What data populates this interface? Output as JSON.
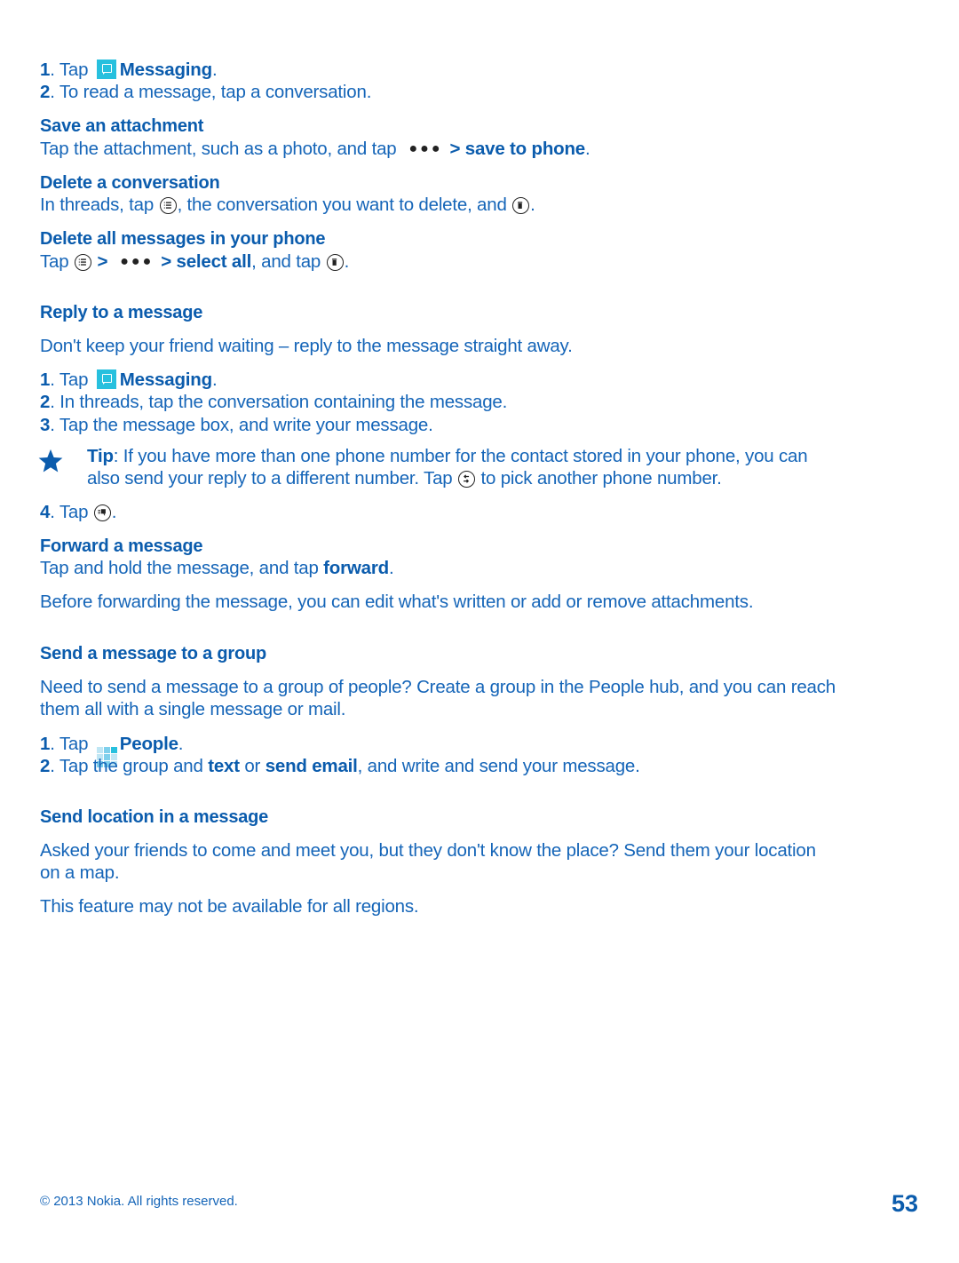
{
  "colors": {
    "body_text": "#1565b8",
    "heading": "#0b5cad",
    "messaging_icon": "#27c0de"
  },
  "intro_steps": [
    {
      "num": "1",
      "pre": ". Tap ",
      "icon": "messaging-app-icon",
      "bold": "Messaging",
      "post": "."
    },
    {
      "num": "2",
      "text": ". To read a message, tap a conversation."
    }
  ],
  "save_attachment": {
    "heading": "Save an attachment",
    "pre": "Tap the attachment, such as a photo, and tap",
    "icon": "more-ellipsis-icon",
    "bold": "> save to phone",
    "post": "."
  },
  "delete_conversation": {
    "heading": "Delete a conversation",
    "pre": "In threads, tap",
    "icon1": "select-list-icon",
    "mid": ", the conversation you want to delete, and",
    "icon2": "delete-trash-icon",
    "post": "."
  },
  "delete_all": {
    "heading": "Delete all messages in your phone",
    "pre": "Tap",
    "icon1": "select-list-icon",
    "sep": ">",
    "icon2": "more-ellipsis-icon",
    "bold": "> select all",
    "mid": ", and tap",
    "icon3": "delete-trash-icon",
    "post": "."
  },
  "reply": {
    "heading": "Reply to a message",
    "intro": "Don't keep your friend waiting – reply to the message straight away.",
    "steps": [
      {
        "num": "1",
        "pre": ". Tap ",
        "icon": "messaging-app-icon",
        "bold": "Messaging",
        "post": "."
      },
      {
        "num": "2",
        "text": ". In threads, tap the conversation containing the message."
      },
      {
        "num": "3",
        "text": ". Tap the message box, and write your message."
      }
    ],
    "tip": {
      "icon": "star-icon",
      "label": "Tip",
      "line1": ": If you have more than one phone number for the contact stored in your phone, you can",
      "line2_pre": "also send your reply to a different number. Tap",
      "line2_icon": "switch-number-icon",
      "line2_post": "to pick another phone number."
    },
    "step4": {
      "num": "4",
      "pre": ". Tap",
      "icon": "send-icon",
      "post": "."
    }
  },
  "forward": {
    "heading": "Forward a message",
    "line_pre": "Tap and hold the message, and tap",
    "line_bold": "forward",
    "line_post": ".",
    "note": "Before forwarding the message, you can edit what's written or add or remove attachments."
  },
  "group": {
    "heading": "Send a message to a group",
    "intro1": "Need to send a message to a group of people? Create a group in the People hub, and you can reach",
    "intro2": "them all with a single message or mail.",
    "steps": [
      {
        "num": "1",
        "pre": ". Tap ",
        "icon": "people-app-icon",
        "bold": "People",
        "post": "."
      },
      {
        "num": "2",
        "pre": ". Tap the group and ",
        "bold1": "text",
        "mid": " or ",
        "bold2": "send email",
        "post": ", and write and send your message."
      }
    ]
  },
  "location": {
    "heading": "Send location in a message",
    "line1": "Asked your friends to come and meet you, but they don't know the place? Send them your location",
    "line2": "on a map.",
    "note": "This feature may not be available for all regions."
  },
  "footer": {
    "copyright": "© 2013 Nokia. All rights reserved.",
    "page_number": "53"
  }
}
